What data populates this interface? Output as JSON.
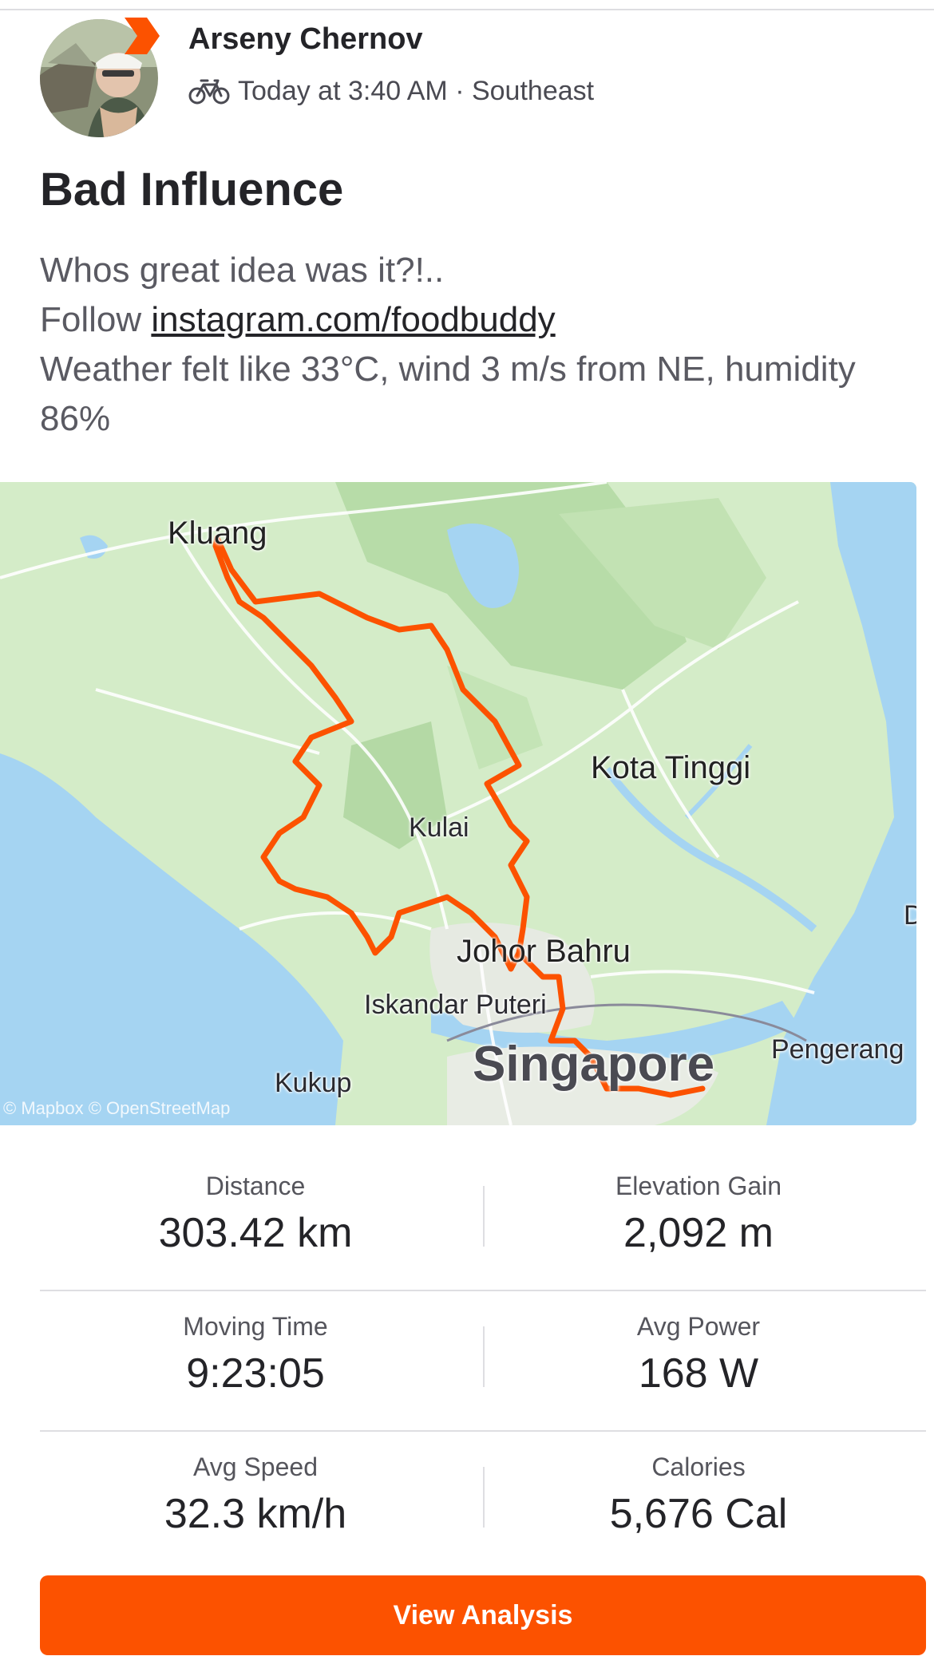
{
  "header": {
    "athlete_name": "Arseny Chernov",
    "activity_icon": "bike-icon",
    "timestamp": "Today at 3:40 AM",
    "separator": "·",
    "location": "Southeast"
  },
  "activity": {
    "title": "Bad Influence",
    "description_line1": "Whos great idea was it?!..",
    "follow_prefix": "Follow",
    "follow_link": "instagram.com/foodbuddy",
    "description_line3": "Weather felt like 33°C, wind 3 m/s from NE, humidity 86%"
  },
  "map": {
    "labels": {
      "kluang": "Kluang",
      "kota_tinggi": "Kota Tinggi",
      "kulai": "Kulai",
      "johor_bahru": "Johor Bahru",
      "iskandar_puteri": "Iskandar Puteri",
      "singapore": "Singapore",
      "pengerang": "Pengerang",
      "kukup": "Kukup",
      "edge_d": "D"
    },
    "attribution": "© Mapbox © OpenStreetMap",
    "route_color": "#fc5200"
  },
  "stats": [
    {
      "label": "Distance",
      "value": "303.42 km"
    },
    {
      "label": "Elevation Gain",
      "value": "2,092 m"
    },
    {
      "label": "Moving Time",
      "value": "9:23:05"
    },
    {
      "label": "Avg Power",
      "value": "168 W"
    },
    {
      "label": "Avg Speed",
      "value": "32.3 km/h"
    },
    {
      "label": "Calories",
      "value": "5,676 Cal"
    }
  ],
  "actions": {
    "view_analysis": "View Analysis"
  },
  "colors": {
    "accent": "#fc5200",
    "text_primary": "#242428",
    "text_secondary": "#5a5a62"
  }
}
